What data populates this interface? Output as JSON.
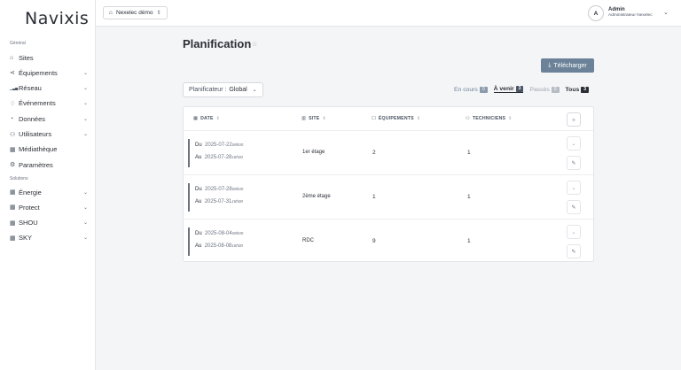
{
  "app": {
    "logo": "Navixis"
  },
  "sidebar": {
    "sections": {
      "general": "Général",
      "solutions": "Solutions"
    },
    "general_items": [
      {
        "label": "Sites",
        "icon": "home-icon",
        "chevron": false
      },
      {
        "label": "Équipements",
        "icon": "share-icon",
        "chevron": true
      },
      {
        "label": "Réseau",
        "icon": "signal-icon",
        "chevron": true
      },
      {
        "label": "Événements",
        "icon": "bell-icon",
        "chevron": true
      },
      {
        "label": "Données",
        "icon": "gauge-icon",
        "chevron": true
      },
      {
        "label": "Utilisateurs",
        "icon": "users-icon",
        "chevron": true
      },
      {
        "label": "Médiathèque",
        "icon": "grid-icon",
        "chevron": false
      },
      {
        "label": "Paramètres",
        "icon": "gear-icon",
        "chevron": false
      }
    ],
    "solution_items": [
      {
        "label": "Énergie",
        "icon": "grid-icon",
        "chevron": true
      },
      {
        "label": "Protect",
        "icon": "grid-icon",
        "chevron": true
      },
      {
        "label": "SHOU",
        "icon": "grid-icon",
        "chevron": true
      },
      {
        "label": "SKY",
        "icon": "grid-icon",
        "chevron": true
      }
    ]
  },
  "topbar": {
    "org": "Nexelec démo",
    "user": {
      "initial": "A",
      "name": "Admin",
      "role": "Administrateur Nexelec"
    }
  },
  "page": {
    "title": "Planification",
    "download": "Télécharger",
    "planner": {
      "label": "Planificateur :",
      "value": "Global"
    },
    "filters": [
      {
        "label": "En cours",
        "count": "0",
        "state": "normal"
      },
      {
        "label": "À venir",
        "count": "3",
        "state": "active"
      },
      {
        "label": "Passés",
        "count": "0",
        "state": "muted"
      },
      {
        "label": "Tous",
        "count": "3",
        "state": "bold"
      }
    ]
  },
  "table": {
    "headers": {
      "date": "DATE",
      "site": "SITE",
      "equipements": "ÉQUIPEMENTS",
      "techniciens": "TECHNICIENS"
    },
    "du": "Du",
    "au": "Au",
    "rows": [
      {
        "start_date": "2025-07-22",
        "start_time": "08h00",
        "end_date": "2025-07-28",
        "end_time": "18h00",
        "site": "1er étage",
        "equipements": "2",
        "techniciens": "1"
      },
      {
        "start_date": "2025-07-28",
        "start_time": "08h00",
        "end_date": "2025-07-31",
        "end_time": "18h00",
        "site": "2ème étage",
        "equipements": "1",
        "techniciens": "1"
      },
      {
        "start_date": "2025-08-04",
        "start_time": "08h00",
        "end_date": "2025-08-08",
        "end_time": "18h00",
        "site": "RDC",
        "equipements": "9",
        "techniciens": "1"
      }
    ]
  }
}
